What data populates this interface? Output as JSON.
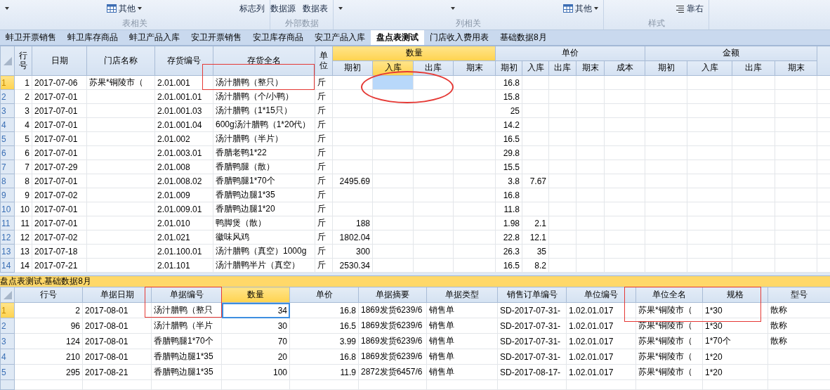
{
  "ribbon": {
    "groups": [
      {
        "label": "表相关",
        "controls": [
          {
            "kind": "caret"
          },
          {
            "kind": "menu",
            "label": "其他"
          },
          {
            "kind": "button",
            "label": "标志列"
          }
        ]
      },
      {
        "label": "外部数据",
        "controls": [
          {
            "kind": "button",
            "label": "数据源"
          },
          {
            "kind": "button",
            "label": "数据表"
          }
        ]
      },
      {
        "label": "列相关",
        "controls": [
          {
            "kind": "caret"
          },
          {
            "kind": "caret"
          },
          {
            "kind": "menu",
            "label": "其他"
          }
        ]
      },
      {
        "label": "样式",
        "controls": [
          {
            "kind": "align",
            "label": "靠右"
          }
        ]
      }
    ]
  },
  "sheet_tabs": [
    {
      "label": "蚌卫开票销售",
      "selected": false
    },
    {
      "label": "蚌卫库存商品",
      "selected": false
    },
    {
      "label": "蚌卫产品入库",
      "selected": false
    },
    {
      "label": "安卫开票销售",
      "selected": false
    },
    {
      "label": "安卫库存商品",
      "selected": false
    },
    {
      "label": "安卫产品入库",
      "selected": false
    },
    {
      "label": "盘点表测试",
      "selected": true
    },
    {
      "label": "门店收入费用表",
      "selected": false
    },
    {
      "label": "基础数据8月",
      "selected": false
    }
  ],
  "upper_grid": {
    "header": [
      {
        "kind": "single",
        "label": "行号",
        "selected": false
      },
      {
        "kind": "single",
        "label": "日期",
        "selected": false
      },
      {
        "kind": "single",
        "label": "门店名称",
        "selected": false
      },
      {
        "kind": "single",
        "label": "存货编号",
        "selected": false
      },
      {
        "kind": "single",
        "label": "存货全名",
        "selected": false,
        "boxed": true
      },
      {
        "kind": "single",
        "label": "单位",
        "selected": false
      },
      {
        "kind": "group",
        "label": "数量",
        "selected": true,
        "columns": [
          {
            "label": "期初",
            "selected": false
          },
          {
            "label": "入库",
            "selected": true,
            "circled": true
          },
          {
            "label": "出库",
            "selected": false
          },
          {
            "label": "期末",
            "selected": false
          }
        ]
      },
      {
        "kind": "group",
        "label": "单价",
        "selected": false,
        "columns": [
          {
            "label": "期初",
            "selected": false
          },
          {
            "label": "入库",
            "selected": false
          },
          {
            "label": "出库",
            "selected": false
          },
          {
            "label": "期末",
            "selected": false
          },
          {
            "label": "成本",
            "selected": false
          }
        ]
      },
      {
        "kind": "group",
        "label": "金额",
        "selected": false,
        "columns": [
          {
            "label": "期初",
            "selected": false
          },
          {
            "label": "入库",
            "selected": false
          },
          {
            "label": "出库",
            "selected": false
          },
          {
            "label": "期末",
            "selected": false
          }
        ]
      }
    ],
    "rows": [
      {
        "number": "1",
        "selected": true,
        "cells": [
          "1",
          "2017-07-06",
          "苏果*铜陵市（",
          "2.01.001",
          "汤汁腊鸭（整只）",
          "斤",
          null,
          null,
          null,
          null,
          "16.8",
          null,
          null,
          null,
          null,
          null,
          null,
          null,
          null
        ]
      },
      {
        "number": "2",
        "selected": false,
        "cells": [
          "2",
          "2017-07-01",
          null,
          "2.01.001.01",
          "汤汁腊鸭（个/小鸭）",
          "斤",
          null,
          null,
          null,
          null,
          "15.8",
          null,
          null,
          null,
          null,
          null,
          null,
          null,
          null
        ]
      },
      {
        "number": "3",
        "selected": false,
        "cells": [
          "3",
          "2017-07-01",
          null,
          "2.01.001.03",
          "汤汁腊鸭（1*15只）",
          "斤",
          null,
          null,
          null,
          null,
          "25",
          null,
          null,
          null,
          null,
          null,
          null,
          null,
          null
        ]
      },
      {
        "number": "4",
        "selected": false,
        "cells": [
          "4",
          "2017-07-01",
          null,
          "2.01.001.04",
          "600g汤汁腊鸭（1*20代）",
          "斤",
          null,
          null,
          null,
          null,
          "14.2",
          null,
          null,
          null,
          null,
          null,
          null,
          null,
          null
        ]
      },
      {
        "number": "5",
        "selected": false,
        "cells": [
          "5",
          "2017-07-01",
          null,
          "2.01.002",
          "汤汁腊鸭（半片）",
          "斤",
          null,
          null,
          null,
          null,
          "16.5",
          null,
          null,
          null,
          null,
          null,
          null,
          null,
          null
        ]
      },
      {
        "number": "6",
        "selected": false,
        "cells": [
          "6",
          "2017-07-01",
          null,
          "2.01.003.01",
          "香腊老鸭1*22",
          "斤",
          null,
          null,
          null,
          null,
          "29.8",
          null,
          null,
          null,
          null,
          null,
          null,
          null,
          null
        ]
      },
      {
        "number": "7",
        "selected": false,
        "cells": [
          "7",
          "2017-07-29",
          null,
          "2.01.008",
          "香腊鸭腿（散）",
          "斤",
          null,
          null,
          null,
          null,
          "15.5",
          null,
          null,
          null,
          null,
          null,
          null,
          null,
          null
        ]
      },
      {
        "number": "8",
        "selected": false,
        "cells": [
          "8",
          "2017-07-01",
          null,
          "2.01.008.02",
          "香腊鸭腿1*70个",
          "斤",
          "2495.69",
          null,
          null,
          null,
          "3.8",
          "7.67",
          null,
          null,
          null,
          null,
          null,
          null,
          null
        ]
      },
      {
        "number": "9",
        "selected": false,
        "cells": [
          "9",
          "2017-07-02",
          null,
          "2.01.009",
          "香腊鸭边腿1*35",
          "斤",
          null,
          null,
          null,
          null,
          "16.8",
          null,
          null,
          null,
          null,
          null,
          null,
          null,
          null
        ]
      },
      {
        "number": "10",
        "selected": false,
        "cells": [
          "10",
          "2017-07-01",
          null,
          "2.01.009.01",
          "香腊鸭边腿1*20",
          "斤",
          null,
          null,
          null,
          null,
          "11.8",
          null,
          null,
          null,
          null,
          null,
          null,
          null,
          null
        ]
      },
      {
        "number": "11",
        "selected": false,
        "cells": [
          "11",
          "2017-07-01",
          null,
          "2.01.010",
          "鸭脚煲（散）",
          "斤",
          "188",
          null,
          null,
          null,
          "1.98",
          "2.1",
          null,
          null,
          null,
          null,
          null,
          null,
          null
        ]
      },
      {
        "number": "12",
        "selected": false,
        "cells": [
          "12",
          "2017-07-02",
          null,
          "2.01.021",
          "徽味风鸡",
          "斤",
          "1802.04",
          null,
          null,
          null,
          "22.8",
          "12.1",
          null,
          null,
          null,
          null,
          null,
          null,
          null
        ]
      },
      {
        "number": "13",
        "selected": false,
        "cells": [
          "13",
          "2017-07-18",
          null,
          "2.01.100.01",
          "汤汁腊鸭（真空）1000g",
          "斤",
          "300",
          null,
          null,
          null,
          "26.3",
          "35",
          null,
          null,
          null,
          null,
          null,
          null,
          null
        ]
      },
      {
        "number": "14",
        "selected": false,
        "cells": [
          "14",
          "2017-07-21",
          null,
          "2.01.101",
          "汤汁腊鸭半片（真空）",
          "斤",
          "2530.34",
          null,
          null,
          null,
          "16.5",
          "8.2",
          null,
          null,
          null,
          null,
          null,
          null,
          null
        ]
      }
    ]
  },
  "lower_bar": {
    "title": "盘点表测试.基础数据8月"
  },
  "lower_grid": {
    "columns": [
      {
        "label": "行号",
        "selected": false
      },
      {
        "label": "单据日期",
        "selected": false
      },
      {
        "label": "单据编号",
        "selected": false,
        "boxed": true
      },
      {
        "label": "数量",
        "selected": true
      },
      {
        "label": "单价",
        "selected": false
      },
      {
        "label": "单据摘要",
        "selected": false
      },
      {
        "label": "单据类型",
        "selected": false
      },
      {
        "label": "销售订单编号",
        "selected": false
      },
      {
        "label": "单位编号",
        "selected": false
      },
      {
        "label": "单位全名",
        "selected": false,
        "boxed": true
      },
      {
        "label": "规格",
        "selected": false,
        "boxed": true
      },
      {
        "label": "型号",
        "selected": false
      }
    ],
    "rows": [
      {
        "number": "1",
        "selected": true,
        "cells": [
          "2",
          "2017-08-01",
          "汤汁腊鸭（整只",
          "34",
          "16.8",
          "1869发货6239/6",
          "销售单",
          "SD-2017-07-31-",
          "1.02.01.017",
          "苏果*铜陵市（",
          "1*30",
          "散称"
        ]
      },
      {
        "number": "2",
        "selected": false,
        "cells": [
          "96",
          "2017-08-01",
          "汤汁腊鸭（半片",
          "30",
          "16.5",
          "1869发货6239/6",
          "销售单",
          "SD-2017-07-31-",
          "1.02.01.017",
          "苏果*铜陵市（",
          "1*30",
          "散称"
        ]
      },
      {
        "number": "3",
        "selected": false,
        "cells": [
          "124",
          "2017-08-01",
          "香腊鸭腿1*70个",
          "70",
          "3.99",
          "1869发货6239/6",
          "销售单",
          "SD-2017-07-31-",
          "1.02.01.017",
          "苏果*铜陵市（",
          "1*70个",
          "散称"
        ]
      },
      {
        "number": "4",
        "selected": false,
        "cells": [
          "210",
          "2017-08-01",
          "香腊鸭边腿1*35",
          "20",
          "16.8",
          "1869发货6239/6",
          "销售单",
          "SD-2017-07-31-",
          "1.02.01.017",
          "苏果*铜陵市（",
          "1*20",
          null
        ]
      },
      {
        "number": "5",
        "selected": false,
        "cells": [
          "295",
          "2017-08-21",
          "香腊鸭边腿1*35",
          "100",
          "11.9",
          "2872发货6457/6",
          "销售单",
          "SD-2017-08-17-",
          "1.02.01.017",
          "苏果*铜陵市（",
          "1*20",
          null
        ]
      }
    ]
  }
}
